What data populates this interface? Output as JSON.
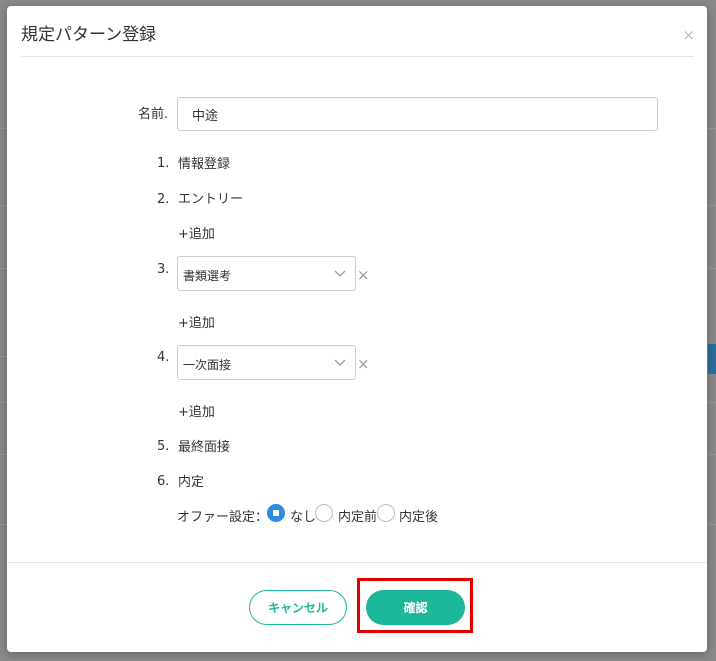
{
  "dialog": {
    "title": "規定パターン登録",
    "close_symbol": "×"
  },
  "form": {
    "name_label": "名前.",
    "name_value": "中途"
  },
  "steps": [
    {
      "number": "1.",
      "label": "情報登録"
    },
    {
      "number": "2.",
      "label": "エントリー"
    },
    {
      "number": "3.",
      "selected": "書類選考"
    },
    {
      "number": "4.",
      "selected": "一次面接"
    },
    {
      "number": "5.",
      "label": "最終面接"
    },
    {
      "number": "6.",
      "label": "内定"
    }
  ],
  "add_label": "+追加",
  "remove_symbol": "×",
  "offer": {
    "label": "オファー設定：",
    "options": [
      "なし",
      "内定前",
      "内定後"
    ],
    "selected": "なし"
  },
  "footer": {
    "cancel_label": "キャンセル",
    "confirm_label": "確認"
  },
  "colors": {
    "accent": "#1bb799",
    "radio_selected": "#2d8ce0",
    "highlight": "#e00000"
  }
}
